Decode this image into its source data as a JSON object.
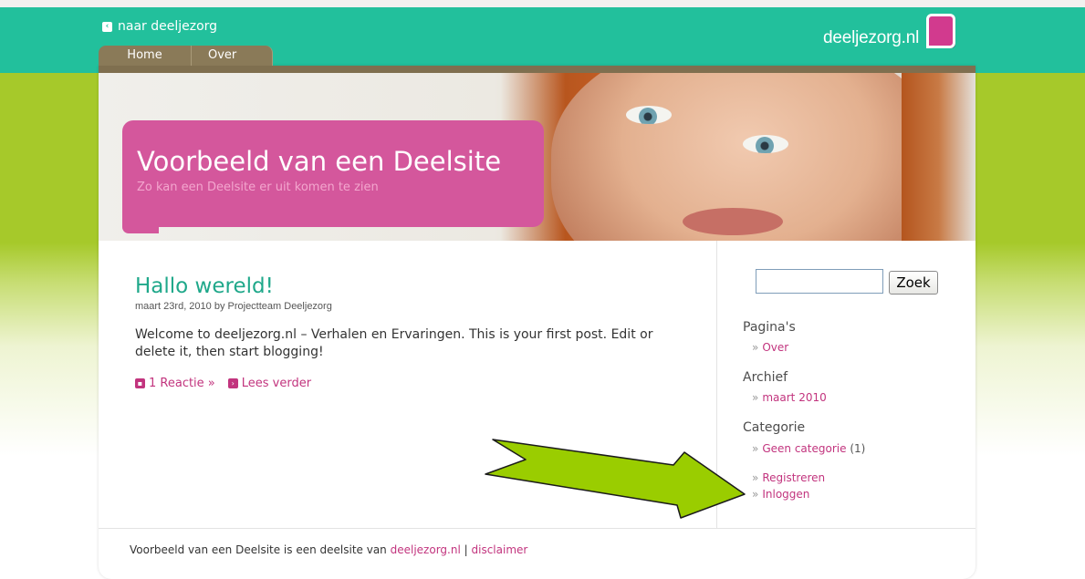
{
  "topbar": {
    "back_link": "naar deeljezorg",
    "logo_text": "deeljezorg.nl"
  },
  "nav": [
    {
      "label": "Home"
    },
    {
      "label": "Over"
    }
  ],
  "header": {
    "title": "Voorbeeld van een Deelsite",
    "subtitle": "Zo kan een Deelsite er uit komen te zien"
  },
  "post": {
    "title": "Hallo wereld!",
    "meta": "maart 23rd, 2010 by Projectteam Deeljezorg",
    "body": "Welcome to deeljezorg.nl – Verhalen en Ervaringen. This is your first post. Edit or delete it, then start blogging!",
    "comments_link": "1 Reactie »",
    "read_more_link": "Lees verder"
  },
  "sidebar": {
    "search_button": "Zoek",
    "search_value": "",
    "pages_title": "Pagina's",
    "pages_items": [
      "Over"
    ],
    "archive_title": "Archief",
    "archive_items": [
      "maart 2010"
    ],
    "category_title": "Categorie",
    "category_items": [
      {
        "label": "Geen categorie",
        "count": "(1)"
      }
    ],
    "meta_items": [
      "Registreren",
      "Inloggen"
    ],
    "bullet": "»"
  },
  "footer": {
    "text": "Voorbeeld van een Deelsite is een deelsite van",
    "link1": "deeljezorg.nl",
    "separator": "|",
    "link2": "disclaimer"
  },
  "colors": {
    "topbar": "#22c09c",
    "band": "#a6c92a",
    "accent_pink": "#d4579c",
    "link_pink": "#c2347e",
    "post_title": "#1fa88a",
    "arrow_fill": "#9acd00"
  },
  "icons": {
    "back": "chevron-left-icon",
    "comments": "comment-icon",
    "read_more": "arrow-right-icon",
    "annotation": "annotation-arrow"
  }
}
